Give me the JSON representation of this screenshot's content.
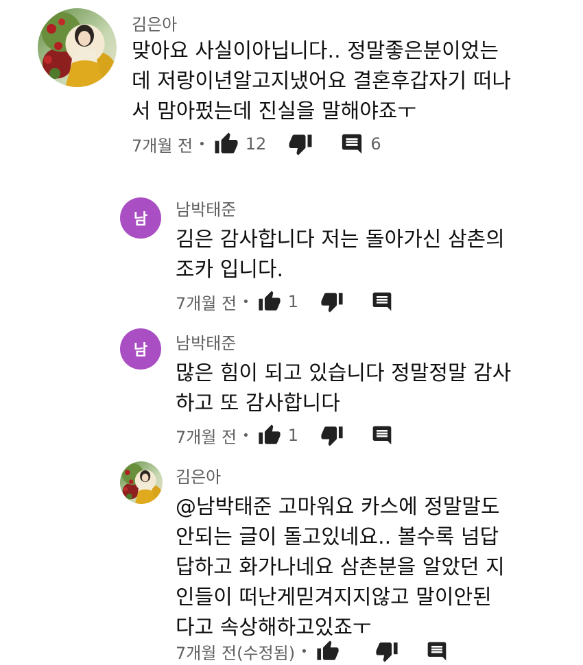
{
  "comments": [
    {
      "author": "김은아",
      "text": "맞아요 사실이아닙니다..  정말좋은분이었는\n데 저랑이년알고지냈어요 결혼후갑자기 떠나\n서 맘아펐는데 진실을 말해야죠ㅜ",
      "time": "7개월 전",
      "likes": "12",
      "replies": "6",
      "avatar_type": "painting"
    }
  ],
  "replies": [
    {
      "author": "남박태준",
      "avatar_letter": "남",
      "text": "김은 감사합니다 저는 돌아가신 삼촌의\n조카 입니다.",
      "time": "7개월 전",
      "likes": "1"
    },
    {
      "author": "남박태준",
      "avatar_letter": "남",
      "text": "많은 힘이 되고 있습니다 정말정말 감사\n하고 또 감사합니다",
      "time": "7개월 전",
      "likes": "1"
    },
    {
      "author": "김은아",
      "text": "@남박태준 고마워요 카스에 정말말도\n안되는 글이 돌고있네요..   볼수록 넘답\n답하고 화가나네요  삼촌분을 알았던 지\n인들이 떠난게믿겨지지않고  말이안된\n다고 속상해하고있죠ㅜ",
      "time": "7개월 전(수정됨)"
    }
  ],
  "separator": "•",
  "colors": {
    "avatar_purple": "#a94fc3",
    "meta_gray": "#606060",
    "text_black": "#0f0f0f",
    "icon_dark": "#212121"
  },
  "icons": [
    "thumbs-up-icon",
    "thumbs-down-icon",
    "comment-reply-icon"
  ]
}
